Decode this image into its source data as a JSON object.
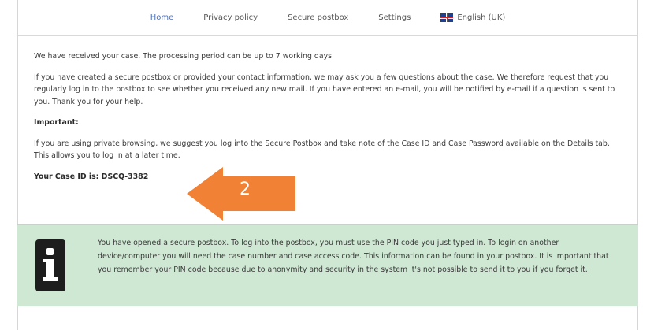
{
  "nav": {
    "items": [
      {
        "label": "Home"
      },
      {
        "label": "Privacy policy"
      },
      {
        "label": "Secure postbox"
      },
      {
        "label": "Settings"
      },
      {
        "label": "English (UK)"
      }
    ]
  },
  "main": {
    "received": "We have received your case. The processing period can be up to 7 working days.",
    "postbox_info": "If you have created a secure postbox or provided your contact information, we may ask you a few questions about the case. We therefore request that you regularly log in to the postbox to see whether you received any new mail. If you have entered an e-mail, you will be notified by e-mail if a question is sent to you. Thank you for your help.",
    "important_label": "Important:",
    "private_browsing": "If you are using private browsing, we suggest you log into the Secure Postbox and take note of the Case ID and Case Password available on the Details tab. This allows you to log in at a later time.",
    "case_id": "Your Case ID is: DSCQ-3382"
  },
  "info_box": {
    "icon": "info-icon",
    "text": "You have opened a secure postbox. To log into the postbox, you must use the PIN code you just typed in. To login on another device/computer you will need the case number and case access code. This information can be found in your postbox. It is important that you remember your PIN code because due to anonymity and security in the system it's not possible to send it to you if you forget it."
  },
  "annotation": {
    "number": "2",
    "color": "#f07a2a"
  },
  "colors": {
    "nav_active": "#4a6fb5",
    "info_bg": "#cfe8d3"
  }
}
